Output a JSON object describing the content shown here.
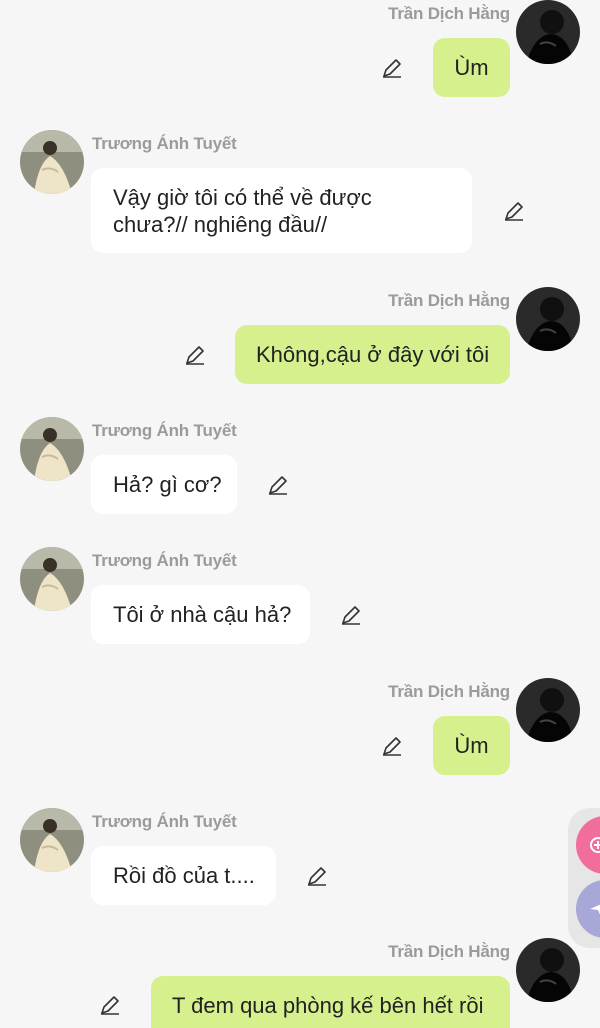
{
  "users": {
    "me": {
      "name": "Trần Dịch Hằng"
    },
    "other": {
      "name": "Trương Ánh Tuyết"
    }
  },
  "messages": [
    {
      "sender": "Trần Dịch Hằng",
      "text": "Ùm"
    },
    {
      "sender": "Trương Ánh Tuyết",
      "text": "Vậy giờ tôi có thể về được chưa?// nghiêng đầu//"
    },
    {
      "sender": "Trần Dịch Hằng",
      "text": "Không,cậu ở đây với tôi"
    },
    {
      "sender": "Trương Ánh Tuyết",
      "text": "Hả? gì cơ?"
    },
    {
      "sender": "Trương Ánh Tuyết",
      "text": "Tôi ở nhà cậu hả?"
    },
    {
      "sender": "Trần Dịch Hằng",
      "text": "Ùm"
    },
    {
      "sender": "Trương Ánh Tuyết",
      "text": "Rồi đồ của t...."
    },
    {
      "sender": "Trần Dịch Hằng",
      "text": "T đem qua phòng kế bên hết rồi"
    }
  ],
  "colors": {
    "background": "#f6f6f6",
    "my_bubble": "#d6f08e",
    "their_bubble": "#ffffff",
    "name_text": "#9b9b9b",
    "fab_pink": "#f16e9c",
    "fab_purple": "#a7a7d8"
  },
  "icons": {
    "edit": "pencil-icon",
    "fab_add": "plus-circle-icon",
    "fab_send": "paper-plane-icon"
  }
}
